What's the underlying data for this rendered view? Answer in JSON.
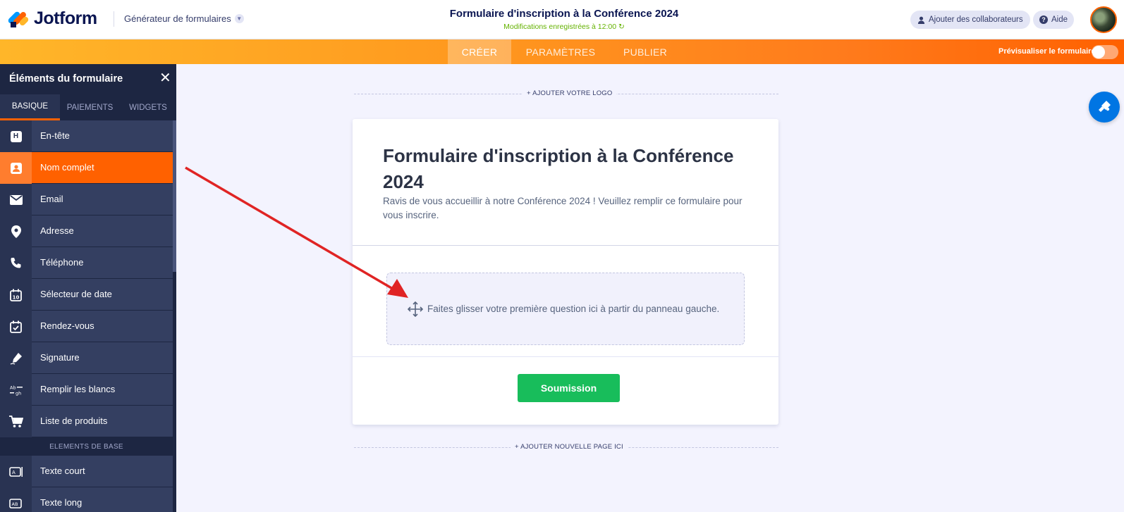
{
  "header": {
    "logo_text": "Jotform",
    "builder_menu": "Générateur de formulaires",
    "form_title": "Formulaire d'inscription à la Conférence 2024",
    "saved_status": "Modifications enregistrées à 12:00",
    "collaborators_button": "Ajouter des collaborateurs",
    "help_button": "Aide"
  },
  "navbar": {
    "tabs": [
      {
        "label": "CRÉER",
        "active": true
      },
      {
        "label": "PARAMÈTRES",
        "active": false
      },
      {
        "label": "PUBLIER",
        "active": false
      }
    ],
    "preview_label": "Prévisualiser le formulaire",
    "preview_enabled": false
  },
  "sidebar": {
    "title": "Éléments du formulaire",
    "tabs": [
      {
        "label": "BASIQUE",
        "active": true
      },
      {
        "label": "PAIEMENTS",
        "active": false
      },
      {
        "label": "WIDGETS",
        "active": false
      }
    ],
    "items": [
      {
        "label": "En-tête",
        "icon": "heading-icon"
      },
      {
        "label": "Nom complet",
        "icon": "user-card-icon",
        "selected": true
      },
      {
        "label": "Email",
        "icon": "envelope-icon"
      },
      {
        "label": "Adresse",
        "icon": "map-pin-icon"
      },
      {
        "label": "Téléphone",
        "icon": "phone-icon"
      },
      {
        "label": "Sélecteur de date",
        "icon": "calendar-icon"
      },
      {
        "label": "Rendez-vous",
        "icon": "calendar-check-icon"
      },
      {
        "label": "Signature",
        "icon": "pen-icon"
      },
      {
        "label": "Remplir les blancs",
        "icon": "fill-blanks-icon"
      },
      {
        "label": "Liste de produits",
        "icon": "cart-icon"
      }
    ],
    "section_label": "ELEMENTS DE BASE",
    "items2": [
      {
        "label": "Texte court",
        "icon": "short-text-icon"
      },
      {
        "label": "Texte long",
        "icon": "long-text-icon"
      }
    ]
  },
  "canvas": {
    "add_logo": "+ AJOUTER VOTRE LOGO",
    "heading": "Formulaire d'inscription à la Conférence 2024",
    "description": "Ravis de vous accueillir à notre Conférence 2024 ! Veuillez remplir ce formulaire pour vous inscrire.",
    "drop_hint": "Faites glisser votre première question ici à partir du panneau gauche.",
    "submit_label": "Soumission",
    "add_page": "+ AJOUTER NOUVELLE PAGE ICI"
  },
  "colors": {
    "brand_orange": "#ff6100",
    "sidebar_bg": "#293352",
    "submit_green": "#18bd5b",
    "saved_green": "#64b200",
    "designer_blue": "#0075e3",
    "annotation_red": "#e02424"
  }
}
